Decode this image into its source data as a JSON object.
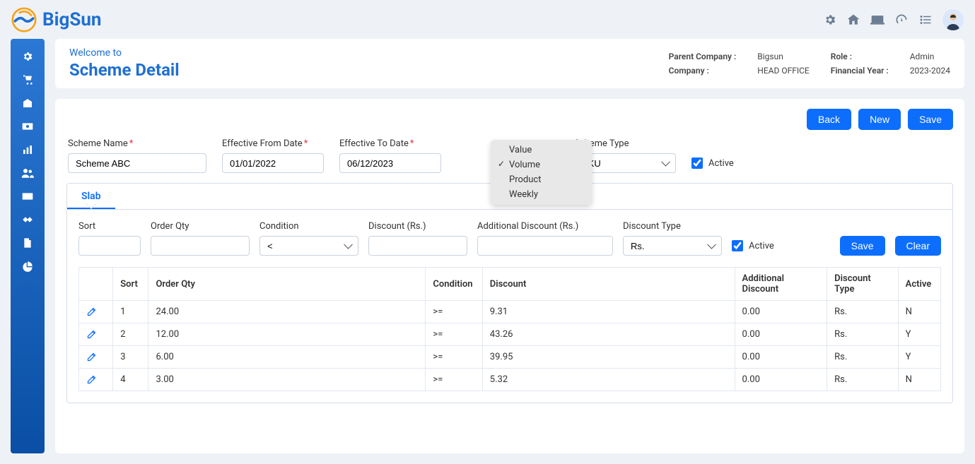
{
  "brand": {
    "name": "BigSun"
  },
  "header": {
    "welcome": "Welcome to",
    "title": "Scheme Detail",
    "meta": {
      "parent_company_lbl": "Parent Company :",
      "parent_company": "Bigsun",
      "role_lbl": "Role :",
      "role": "Admin",
      "company_lbl": "Company :",
      "company": "HEAD OFFICE",
      "fy_lbl": "Financial Year :",
      "fy": "2023-2024"
    }
  },
  "buttons": {
    "back": "Back",
    "new": "New",
    "save": "Save",
    "clear": "Clear"
  },
  "form": {
    "scheme_name_lbl": "Scheme Name",
    "scheme_name": "Scheme ABC",
    "eff_from_lbl": "Effective From Date",
    "eff_from": "01/01/2022",
    "eff_to_lbl": "Effective To Date",
    "eff_to": "06/12/2023",
    "scheme_type_lbl": "Scheme Type",
    "scheme_type": "SKU",
    "active_lbl": "Active"
  },
  "dropdown": {
    "opts": [
      "Value",
      "Volume",
      "Product",
      "Weekly"
    ],
    "selected_index": 1
  },
  "slab": {
    "tab": "Slab",
    "headers": {
      "sort": "Sort",
      "order_qty": "Order Qty",
      "condition": "Condition",
      "discount_rs": "Discount (Rs.)",
      "add_discount_rs": "Additional Discount (Rs.)",
      "discount_type": "Discount Type",
      "discount": "Discount",
      "add_discount": "Additional Discount",
      "active": "Active"
    },
    "form": {
      "condition_sel": "<",
      "discount_type_sel": "Rs."
    },
    "rows": [
      {
        "sort": "1",
        "qty": "24.00",
        "cond": ">=",
        "disc": "9.31",
        "add": "0.00",
        "type": "Rs.",
        "active": "N"
      },
      {
        "sort": "2",
        "qty": "12.00",
        "cond": ">=",
        "disc": "43.26",
        "add": "0.00",
        "type": "Rs.",
        "active": "Y"
      },
      {
        "sort": "3",
        "qty": "6.00",
        "cond": ">=",
        "disc": "39.95",
        "add": "0.00",
        "type": "Rs.",
        "active": "Y"
      },
      {
        "sort": "4",
        "qty": "3.00",
        "cond": ">=",
        "disc": "5.32",
        "add": "0.00",
        "type": "Rs.",
        "active": "N"
      }
    ]
  }
}
